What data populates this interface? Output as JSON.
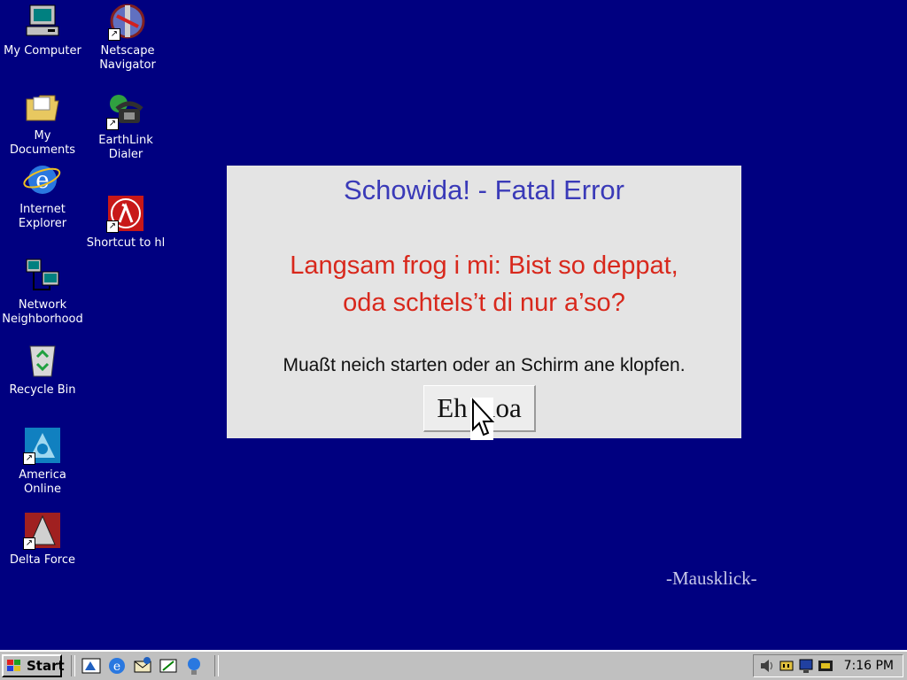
{
  "desktop": {
    "icons": [
      {
        "label": "My Computer",
        "icon": "computer-icon"
      },
      {
        "label": "Netscape Navigator",
        "icon": "netscape-icon"
      },
      {
        "label": "My Documents",
        "icon": "folder-icon"
      },
      {
        "label": "EarthLink Dialer",
        "icon": "phone-icon"
      },
      {
        "label": "Internet Explorer",
        "icon": "ie-icon"
      },
      {
        "label": "Shortcut to hl",
        "icon": "half-life-icon"
      },
      {
        "label": "Network Neighborhood",
        "icon": "network-icon"
      },
      {
        "label": "Recycle Bin",
        "icon": "recycle-bin-icon"
      },
      {
        "label": "America Online",
        "icon": "aol-icon"
      },
      {
        "label": "Delta Force",
        "icon": "delta-force-icon"
      }
    ]
  },
  "dialog": {
    "title": "Schowida! - Fatal Error",
    "message_line1": "Langsam frog i mi: Bist  so deppat,",
    "message_line2": "oda schtels’t di nur a’so?",
    "instruction": "Muaßt neich starten oder an Schirm ane klopfen.",
    "button_label": "Eh kloa"
  },
  "caption": "-Mausklick-",
  "taskbar": {
    "start_label": "Start",
    "clock": "7:16 PM"
  },
  "colors": {
    "desktop": "#000080",
    "title": "#3a3ab8",
    "message": "#d8281c"
  }
}
